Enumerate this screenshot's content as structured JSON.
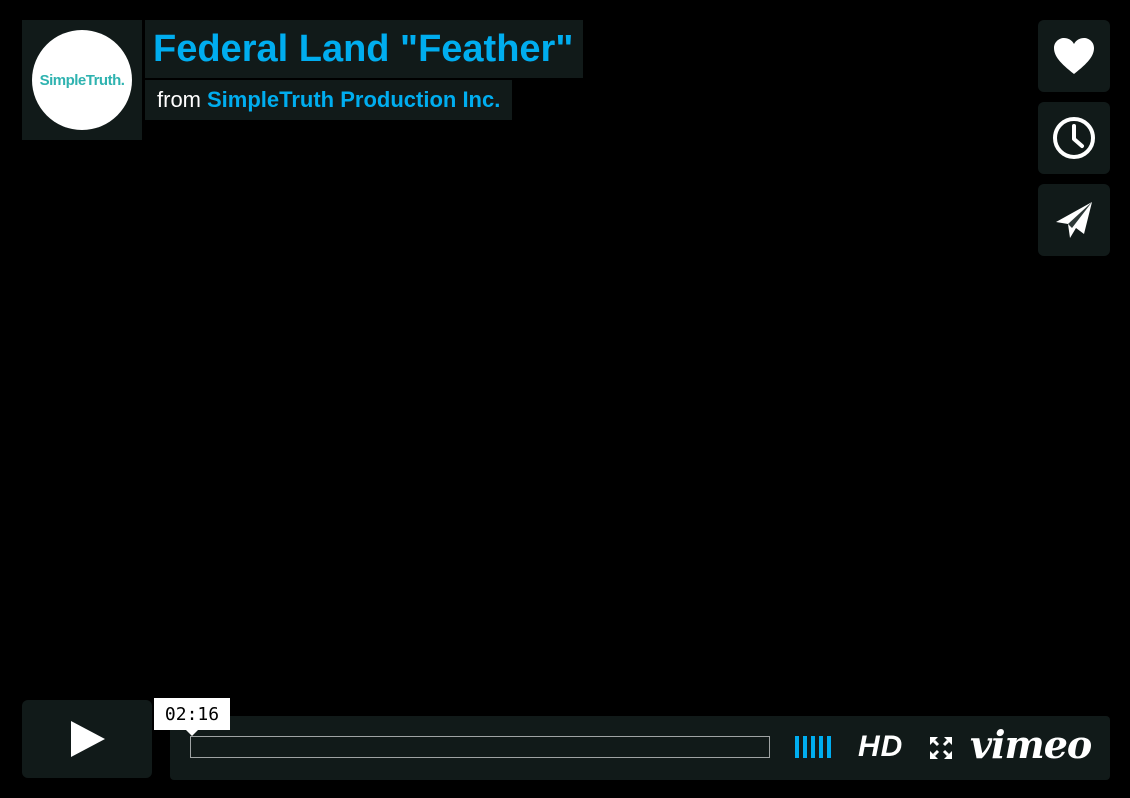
{
  "video": {
    "title": "Federal Land \"Feather\"",
    "byline_prefix": "from",
    "owner": "SimpleTruth Production Inc.",
    "avatar_text": "SimpleTruth."
  },
  "sidedock": {
    "like_icon": "heart-icon",
    "watch_later_icon": "clock-icon",
    "share_icon": "paper-plane-icon"
  },
  "controls": {
    "play_icon": "play-icon",
    "timecode": "02:16",
    "progress_percent": 0,
    "volume_bars": 5,
    "hd_label": "HD",
    "fullscreen_icon": "fullscreen-icon",
    "logo_text": "vimeo"
  },
  "colors": {
    "accent": "#00adef",
    "panel": "#172322",
    "avatar_text": "#2fb3b0"
  }
}
